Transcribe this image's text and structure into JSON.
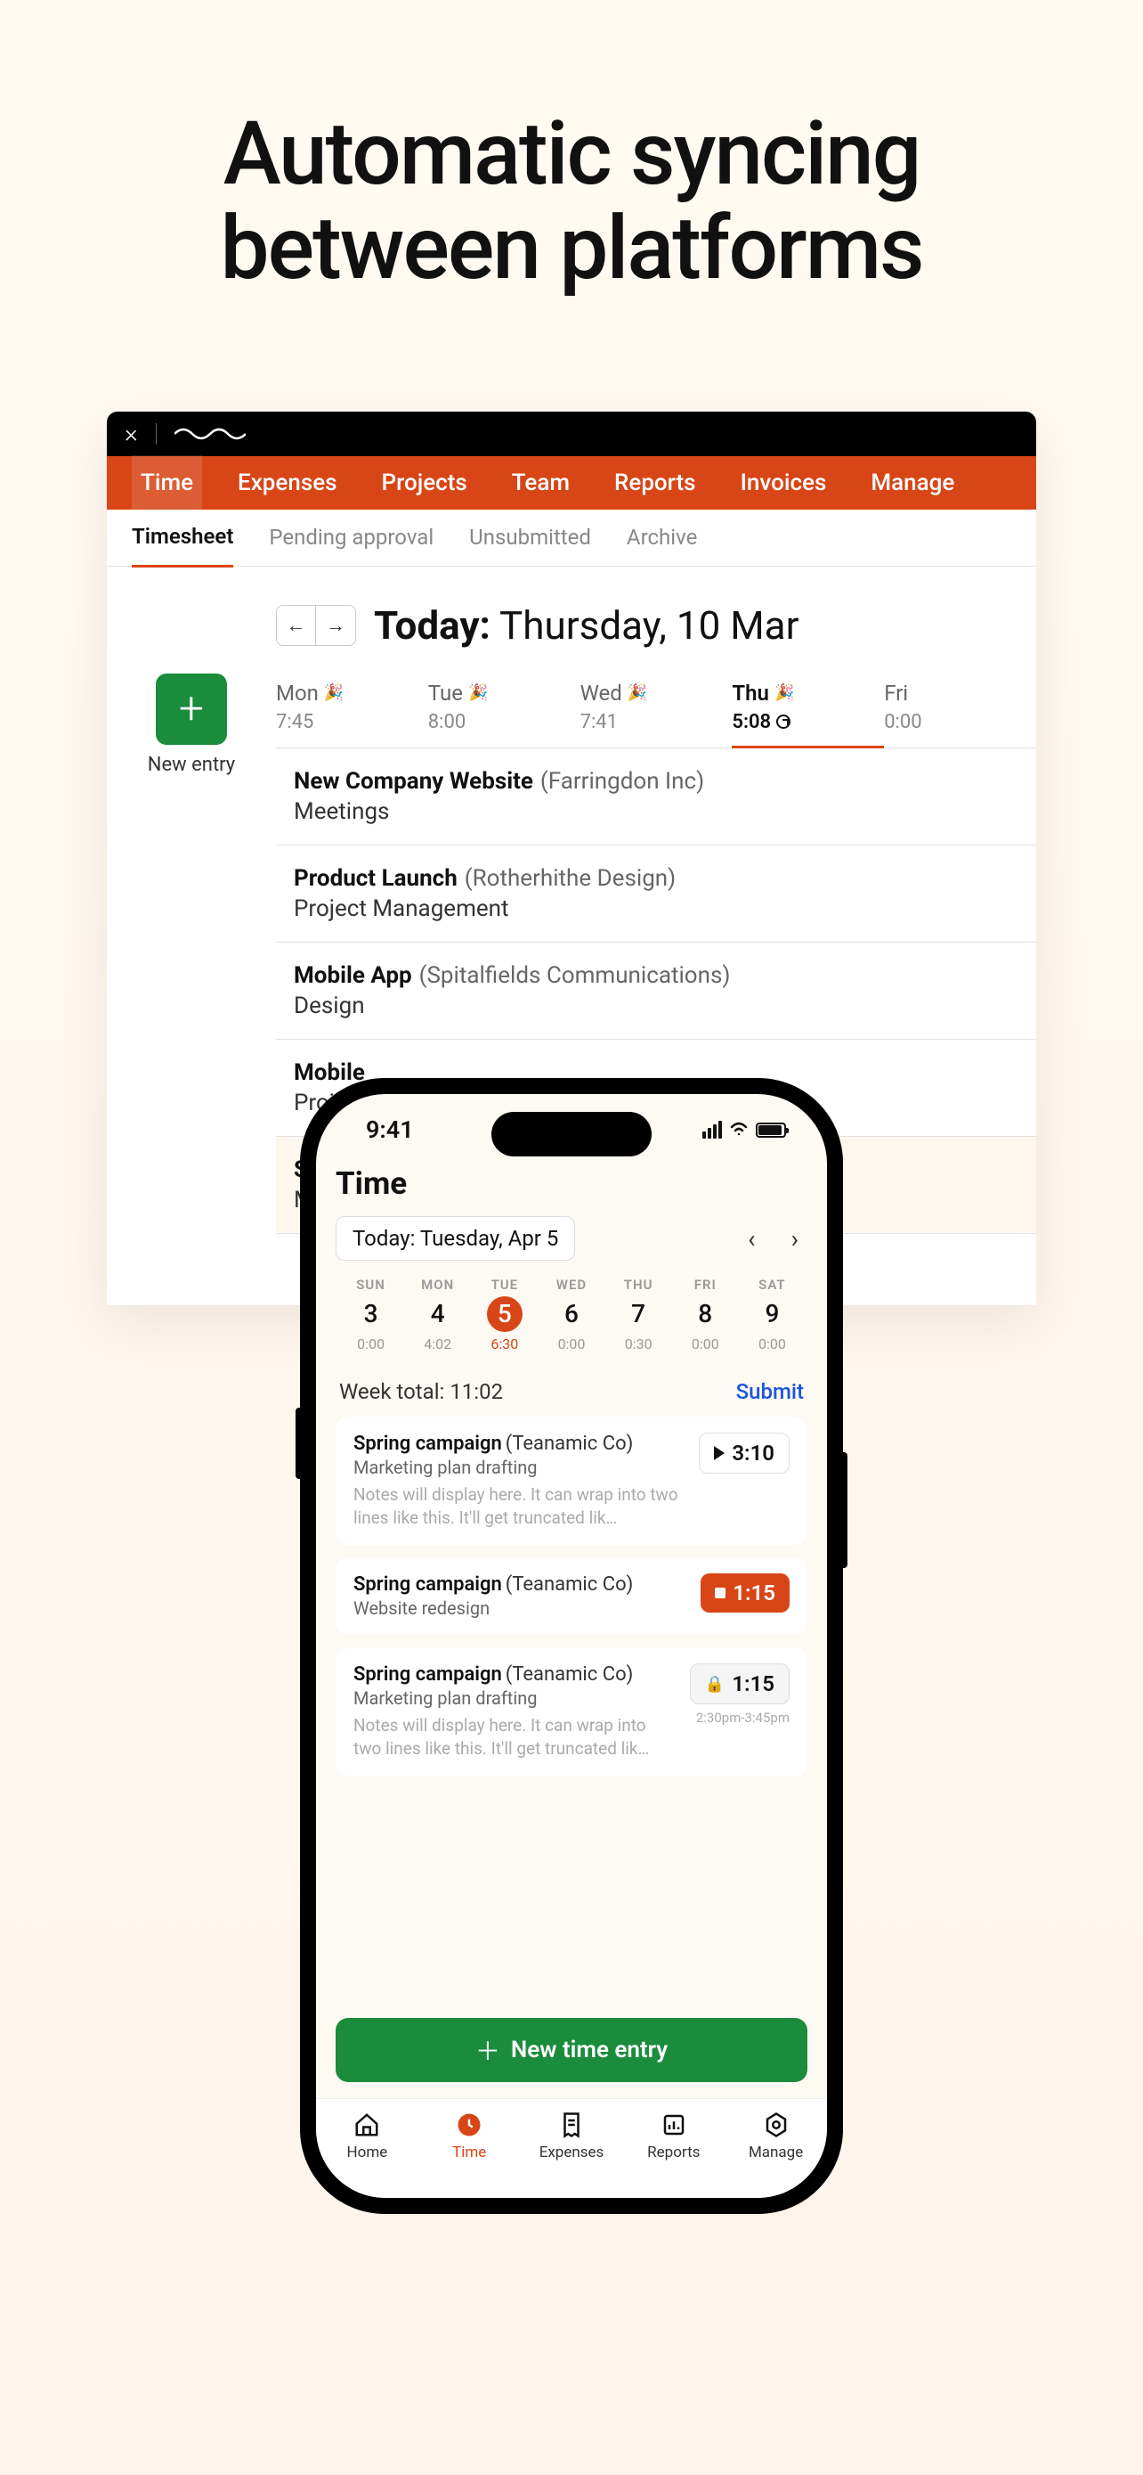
{
  "hero": {
    "line1": "Automatic syncing",
    "line2": "between platforms"
  },
  "desktop": {
    "top_nav": {
      "time": "Time",
      "expenses": "Expenses",
      "projects": "Projects",
      "team": "Team",
      "reports": "Reports",
      "invoices": "Invoices",
      "manage": "Manage"
    },
    "sub_nav": {
      "timesheet": "Timesheet",
      "pending": "Pending approval",
      "unsubmitted": "Unsubmitted",
      "archive": "Archive"
    },
    "today_prefix": "Today:",
    "today_date": "Thursday, 10 Mar",
    "new_entry_label": "New entry",
    "days": [
      {
        "label": "Mon",
        "confetti": true,
        "time": "7:45"
      },
      {
        "label": "Tue",
        "confetti": true,
        "time": "8:00"
      },
      {
        "label": "Wed",
        "confetti": true,
        "time": "7:41"
      },
      {
        "label": "Thu",
        "confetti": true,
        "time": "5:08",
        "clock": true
      },
      {
        "label": "Fri",
        "confetti": false,
        "time": "0:00"
      }
    ],
    "entries": [
      {
        "title": "New Company Website",
        "client": "(Farringdon Inc)",
        "sub": "Meetings"
      },
      {
        "title": "Product Launch",
        "client": "(Rotherhithe Design)",
        "sub": "Project Management"
      },
      {
        "title": "Mobile App",
        "client": "(Spitalfields Communications)",
        "sub": "Design"
      },
      {
        "title": "Mobile",
        "client": "",
        "sub": "Projec"
      },
      {
        "title": "Summe",
        "client": "",
        "sub": "Meetin"
      }
    ]
  },
  "phone": {
    "status_time": "9:41",
    "title": "Time",
    "date_pill": "Today: Tuesday, Apr 5",
    "week": [
      {
        "dow": "SUN",
        "num": "3",
        "dur": "0:00"
      },
      {
        "dow": "MON",
        "num": "4",
        "dur": "4:02"
      },
      {
        "dow": "TUE",
        "num": "5",
        "dur": "6:30"
      },
      {
        "dow": "WED",
        "num": "6",
        "dur": "0:00"
      },
      {
        "dow": "THU",
        "num": "7",
        "dur": "0:30"
      },
      {
        "dow": "FRI",
        "num": "8",
        "dur": "0:00"
      },
      {
        "dow": "SAT",
        "num": "9",
        "dur": "0:00"
      }
    ],
    "week_total_label": "Week total: 11:02",
    "submit_label": "Submit",
    "entries": [
      {
        "title": "Spring campaign",
        "client": "(Teanamic Co)",
        "sub": "Marketing plan drafting",
        "notes": "Notes will display here. It can wrap into two lines like this. It'll get truncated lik…",
        "time": "3:10",
        "kind": "play"
      },
      {
        "title": "Spring campaign",
        "client": "(Teanamic Co)",
        "sub": "Website redesign",
        "notes": "",
        "time": "1:15",
        "kind": "stop"
      },
      {
        "title": "Spring campaign",
        "client": "(Teanamic Co)",
        "sub": "Marketing plan drafting",
        "notes": "Notes will display here. It can wrap into two lines like this. It'll get truncated lik…",
        "time": "1:15",
        "kind": "lock",
        "range": "2:30pm-3:45pm"
      }
    ],
    "new_entry_btn": "New time entry",
    "tabs": {
      "home": "Home",
      "time": "Time",
      "expenses": "Expenses",
      "reports": "Reports",
      "manage": "Manage"
    }
  }
}
